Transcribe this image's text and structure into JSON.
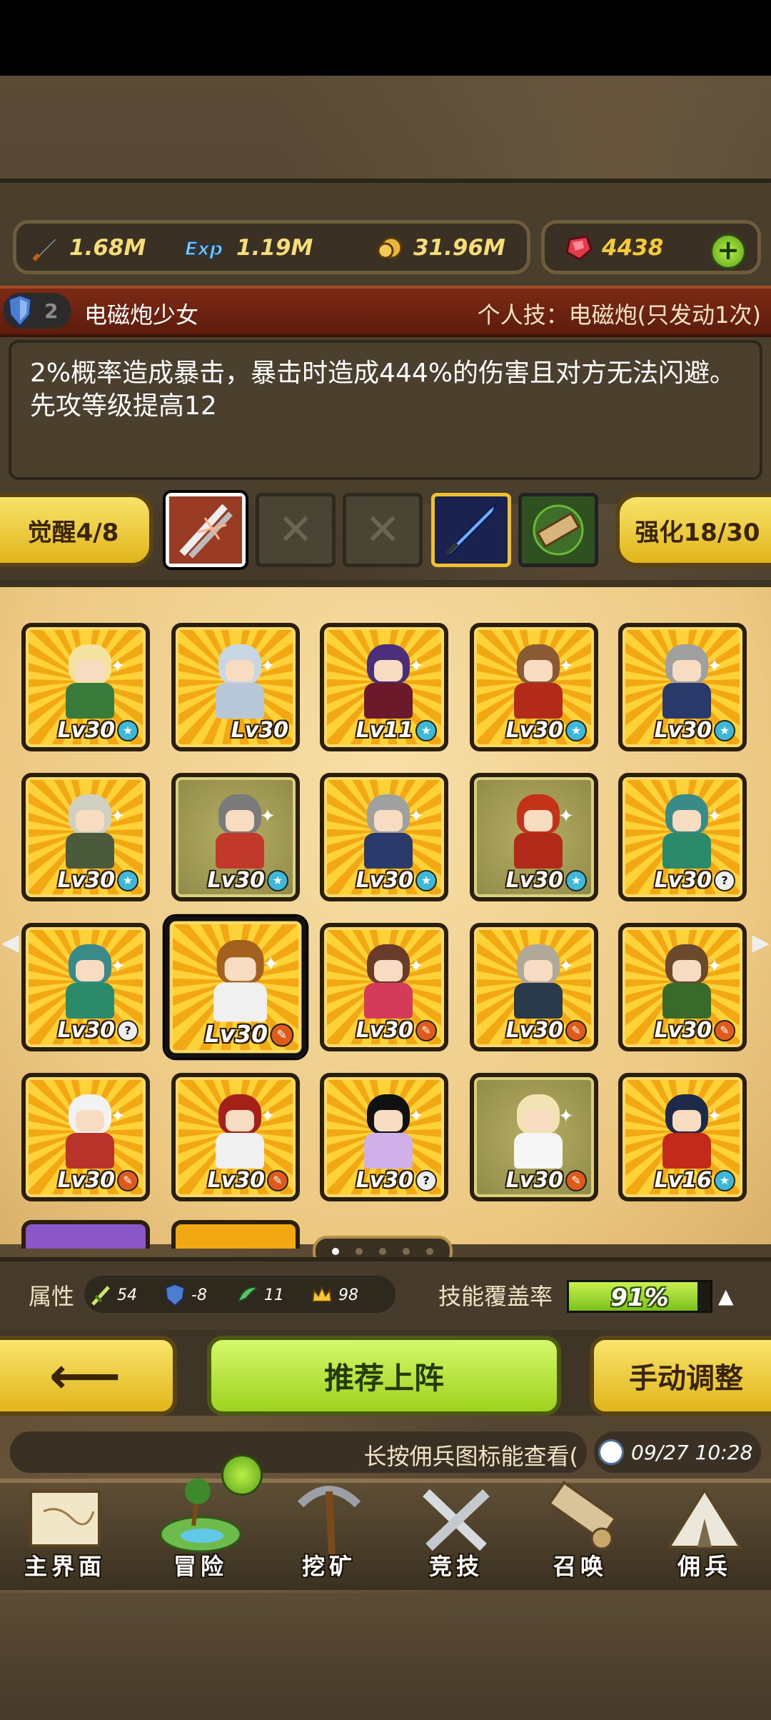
{
  "resources": {
    "attack": "1.68M",
    "exp": "1.19M",
    "gold": "31.96M",
    "gems": "4438"
  },
  "hero": {
    "tier": "2",
    "name": "电磁炮少女",
    "skill_title": "个人技：电磁炮(只发动1次)",
    "description": "2%概率造成暴击，暴击时造成444%的伤害且对方无法闪避。先攻等级提高12"
  },
  "equip_row": {
    "awaken_label": "觉醒4/8",
    "enhance_label": "强化18/30"
  },
  "heroes": [
    {
      "level": "Lv30",
      "badge": "star"
    },
    {
      "level": "Lv30",
      "badge": ""
    },
    {
      "level": "Lv11",
      "badge": "star"
    },
    {
      "level": "Lv30",
      "badge": "star"
    },
    {
      "level": "Lv30",
      "badge": "star"
    },
    {
      "level": "Lv30",
      "badge": "star"
    },
    {
      "level": "Lv30",
      "badge": "star"
    },
    {
      "level": "Lv30",
      "badge": "star"
    },
    {
      "level": "Lv30",
      "badge": "star"
    },
    {
      "level": "Lv30",
      "badge": "q"
    },
    {
      "level": "Lv30",
      "badge": "q"
    },
    {
      "level": "Lv30",
      "badge": "r"
    },
    {
      "level": "Lv30",
      "badge": "r"
    },
    {
      "level": "Lv30",
      "badge": "r"
    },
    {
      "level": "Lv30",
      "badge": "r"
    },
    {
      "level": "Lv30",
      "badge": "r"
    },
    {
      "level": "Lv30",
      "badge": "r"
    },
    {
      "level": "Lv30",
      "badge": "q"
    },
    {
      "level": "Lv30",
      "badge": "r"
    },
    {
      "level": "Lv16",
      "badge": "star"
    }
  ],
  "pagination": {
    "pages": 5,
    "current": 1
  },
  "attributes": {
    "label": "属性",
    "values": [
      "54",
      "-8",
      "11",
      "98"
    ],
    "coverage_label": "技能覆盖率",
    "coverage_value": "91%",
    "coverage_fraction": 0.91
  },
  "actions": {
    "back": "⟵",
    "recommend": "推荐上阵",
    "manual": "手动调整"
  },
  "ticker": "长按佣兵图标能查看(",
  "time": "09/27 10:28",
  "nav": [
    "主界面",
    "冒险",
    "挖矿",
    "竞技",
    "召唤",
    "佣兵"
  ],
  "colors": {
    "accent_green": "#9ed21e",
    "accent_gold": "#e1b51c",
    "title_red": "#7d2a14"
  }
}
